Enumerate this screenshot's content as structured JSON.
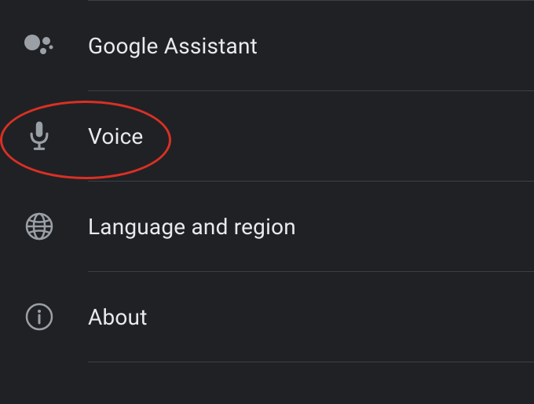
{
  "settings": {
    "items": [
      {
        "label": "Google Assistant",
        "icon": "assistant-icon"
      },
      {
        "label": "Voice",
        "icon": "mic-icon"
      },
      {
        "label": "Language and region",
        "icon": "globe-icon"
      },
      {
        "label": "About",
        "icon": "info-icon"
      }
    ]
  },
  "highlighted_item_index": 1
}
